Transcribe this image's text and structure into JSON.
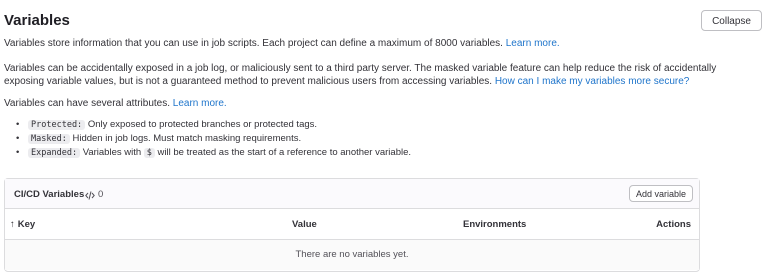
{
  "section": {
    "title": "Variables",
    "collapse_label": "Collapse"
  },
  "intro": {
    "text": "Variables store information that you can use in job scripts. Each project can define a maximum of 8000 variables.",
    "link": "Learn more."
  },
  "warning": {
    "text": "Variables can be accidentally exposed in a job log, or maliciously sent to a third party server. The masked variable feature can help reduce the risk of accidentally exposing variable values, but is not a guaranteed method to prevent malicious users from accessing variables.",
    "link": "How can I make my variables more secure?"
  },
  "attributes_intro": {
    "text": "Variables can have several attributes.",
    "link": "Learn more."
  },
  "attributes": [
    {
      "name": "Protected:",
      "desc": "Only exposed to protected branches or protected tags."
    },
    {
      "name": "Masked:",
      "desc": "Hidden in job logs. Must match masking requirements."
    },
    {
      "name": "Expanded:",
      "desc_before": "Variables with",
      "symbol": "$",
      "desc_after": "will be treated as the start of a reference to another variable."
    }
  ],
  "card": {
    "title": "CI/CD Variables",
    "count": "0",
    "count_icon": "code-icon",
    "add_label": "Add variable",
    "columns": {
      "sort_arrow": "↑",
      "key": "Key",
      "value": "Value",
      "environments": "Environments",
      "actions": "Actions"
    },
    "empty_text": "There are no variables yet."
  }
}
